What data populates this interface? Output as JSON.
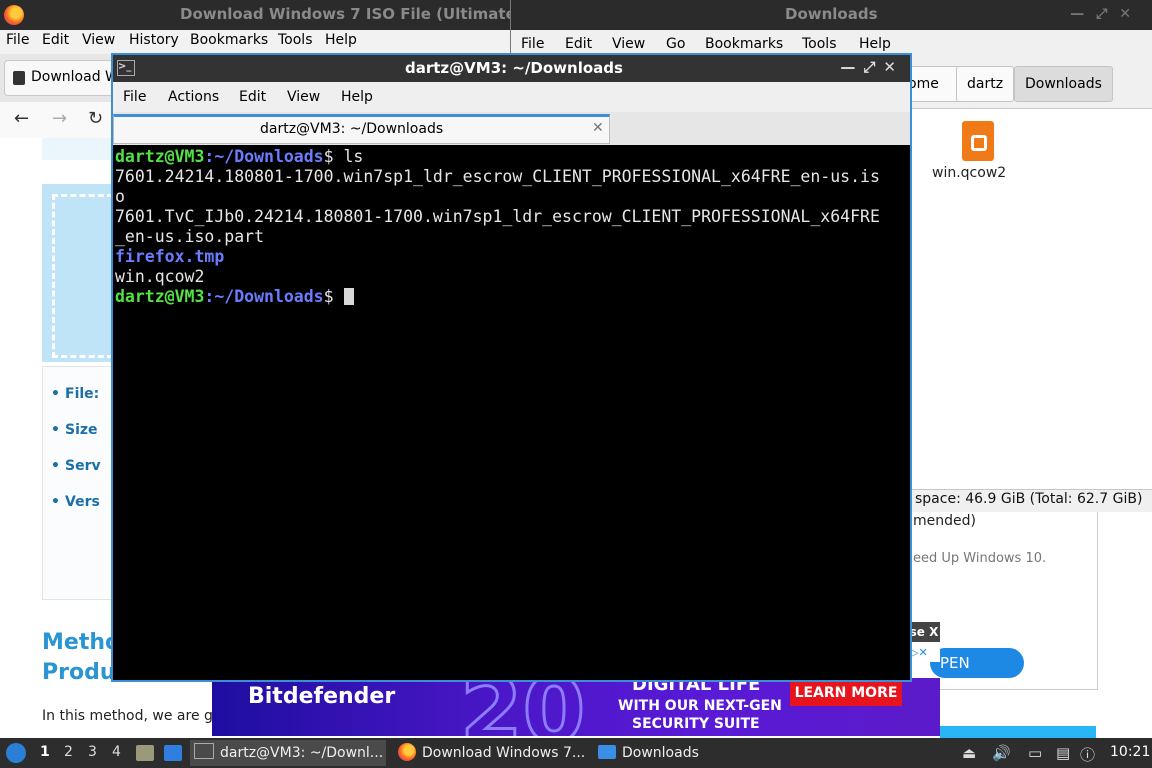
{
  "firefox": {
    "title": "Download Windows 7 ISO File (Ultimate",
    "menu": [
      "File",
      "Edit",
      "View",
      "History",
      "Bookmarks",
      "Tools",
      "Help"
    ],
    "tab_label": "Download W",
    "bullets": [
      "File:",
      "Size",
      "Serv",
      "Vers"
    ],
    "method_line1": "Metho",
    "method_line2": "Produ",
    "intro_text": "In this method, we are go",
    "panel_line1": "mended)",
    "panel_line2": "eed Up Windows 10.",
    "close_ad": "se X",
    "open_btn": "PEN",
    "ad": {
      "brand": "Bitdefender",
      "big_number": "20",
      "line1": "DIGITAL LIFE",
      "line2": "WITH OUR NEXT-GEN",
      "line3": "SECURITY SUITE",
      "cta": "LEARN MORE"
    }
  },
  "filemanager": {
    "title": "Downloads",
    "menu": [
      "File",
      "Edit",
      "View",
      "Go",
      "Bookmarks",
      "Tools",
      "Help"
    ],
    "breadcrumbs": [
      "ome",
      "dartz",
      "Downloads"
    ],
    "file_name": "win.qcow2",
    "status": "space: 46.9 GiB (Total: 62.7 GiB)"
  },
  "terminal": {
    "title": "dartz@VM3: ~/Downloads",
    "menu": [
      "File",
      "Actions",
      "Edit",
      "View",
      "Help"
    ],
    "tab_label": "dartz@VM3: ~/Downloads",
    "prompt_user": "dartz@VM3",
    "prompt_path": ":~/Downloads",
    "prompt_end": "$ ",
    "command": "ls",
    "out1a": "7601.24214.180801-1700.win7sp1_ldr_escrow_CLIENT_PROFESSIONAL_x64FRE_en-us.is",
    "out1b": "o",
    "out2a": "7601.TvC_IJb0.24214.180801-1700.win7sp1_ldr_escrow_CLIENT_PROFESSIONAL_x64FRE",
    "out2b": "_en-us.iso.part",
    "out3": "firefox.tmp",
    "out4": "win.qcow2"
  },
  "taskbar": {
    "workspaces": [
      "1",
      "2",
      "3",
      "4"
    ],
    "task_terminal": "dartz@VM3: ~/Downl...",
    "task_firefox": "Download Windows 7...",
    "task_files": "Downloads",
    "clock": "10:21"
  }
}
